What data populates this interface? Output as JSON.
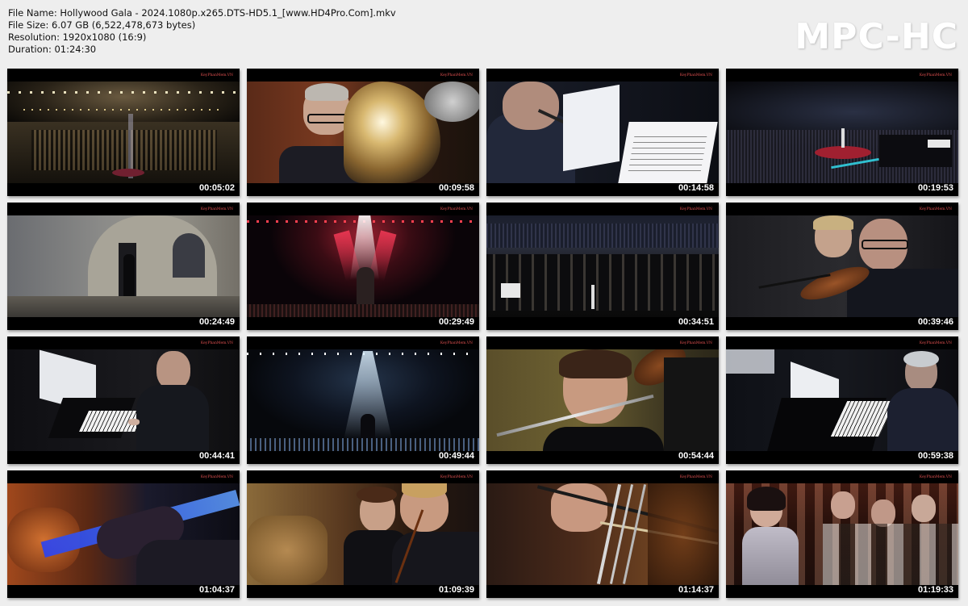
{
  "file_info": {
    "file_name": "File Name: Hollywood Gala - 2024.1080p.x265.DTS-HD5.1_[www.HD4Pro.Com].mkv",
    "file_size": "File Size: 6.07 GB (6,522,478,673 bytes)",
    "resolution": "Resolution: 1920x1080 (16:9)",
    "duration": "Duration: 01:24:30"
  },
  "logo_text": "MPC-HC",
  "watermark": "KeyPhanMem.VN",
  "thumbnails": [
    {
      "timestamp": "00:05:02",
      "scene": "concert-hall-stage-lights"
    },
    {
      "timestamp": "00:09:58",
      "scene": "tuba-player"
    },
    {
      "timestamp": "00:14:58",
      "scene": "piccolo-player-sheet-music"
    },
    {
      "timestamp": "00:19:53",
      "scene": "dark-arena-red-stage"
    },
    {
      "timestamp": "00:24:49",
      "scene": "stone-wall-doorway"
    },
    {
      "timestamp": "00:29:49",
      "scene": "singer-red-spotlights"
    },
    {
      "timestamp": "00:34:51",
      "scene": "orchestra-strings-wide"
    },
    {
      "timestamp": "00:39:46",
      "scene": "violinists-closeup"
    },
    {
      "timestamp": "00:44:41",
      "scene": "pianist-left"
    },
    {
      "timestamp": "00:49:44",
      "scene": "conductor-spotlight"
    },
    {
      "timestamp": "00:54:44",
      "scene": "flutist-closeup"
    },
    {
      "timestamp": "00:59:38",
      "scene": "pianist-right"
    },
    {
      "timestamp": "01:04:37",
      "scene": "blue-lit-hand"
    },
    {
      "timestamp": "01:09:39",
      "scene": "cellists"
    },
    {
      "timestamp": "01:14:37",
      "scene": "cello-bow-closeup"
    },
    {
      "timestamp": "01:19:33",
      "scene": "audience-singer"
    }
  ]
}
